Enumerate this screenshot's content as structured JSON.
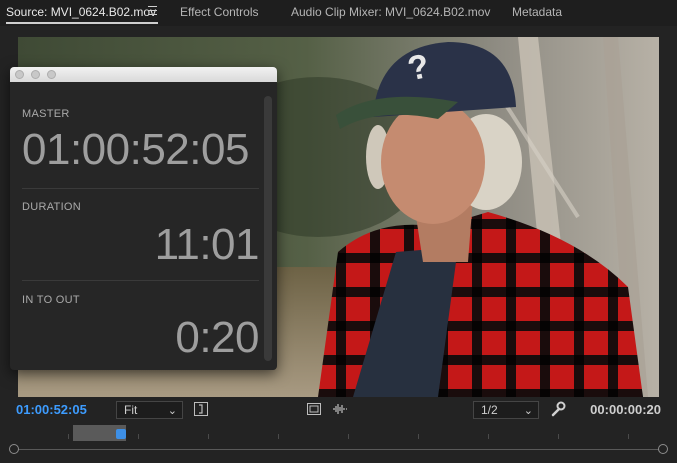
{
  "tabs": [
    {
      "label": "Source: MVI_0624.B02.mov",
      "active": true
    },
    {
      "label": "Effect Controls",
      "active": false
    },
    {
      "label": "Audio Clip Mixer: MVI_0624.B02.mov",
      "active": false
    },
    {
      "label": "Metadata",
      "active": false
    }
  ],
  "timecode_window": {
    "sections": [
      {
        "label": "MASTER",
        "value": "01:00:52:05"
      },
      {
        "label": "DURATION",
        "value": "11:01"
      },
      {
        "label": "IN TO OUT",
        "value": "0:20"
      }
    ]
  },
  "controls": {
    "current_timecode": "01:00:52:05",
    "zoom_select": "Fit",
    "resolution_select": "1/2",
    "duration_timecode": "00:00:00:20",
    "icons": [
      "insert-bracket-icon",
      "safe-margins-icon",
      "audio-waveform-icon",
      "wrench-icon"
    ]
  },
  "colors": {
    "accent_timecode": "#3d9cff",
    "playhead": "#3d8fe6"
  }
}
